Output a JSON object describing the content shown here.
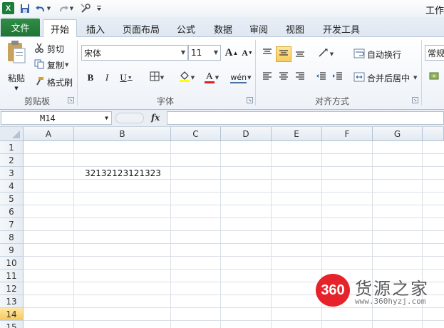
{
  "window": {
    "title": "工作"
  },
  "quick_access": {
    "app_icon": "X",
    "save_icon": "floppy-disk-icon",
    "undo_icon": "undo-icon",
    "redo_icon": "redo-icon",
    "customize_icon": "customize-icon"
  },
  "tabs": [
    {
      "label": "文件",
      "type": "file"
    },
    {
      "label": "开始",
      "active": true
    },
    {
      "label": "插入"
    },
    {
      "label": "页面布局"
    },
    {
      "label": "公式"
    },
    {
      "label": "数据"
    },
    {
      "label": "审阅"
    },
    {
      "label": "视图"
    },
    {
      "label": "开发工具"
    }
  ],
  "ribbon": {
    "clipboard": {
      "label": "剪贴板",
      "paste": "粘贴",
      "cut": "剪切",
      "copy": "复制",
      "format_painter": "格式刷"
    },
    "font": {
      "label": "字体",
      "font_name": "宋体",
      "font_size": "11",
      "bold": "B",
      "italic": "I",
      "underline": "U",
      "grow": "A",
      "shrink": "A",
      "font_color": "A",
      "wen": "wén"
    },
    "alignment": {
      "label": "对齐方式",
      "wrap_text": "自动换行",
      "merge_center": "合并后居中"
    },
    "number": {
      "format": "常规"
    }
  },
  "formula_bar": {
    "name_box": "M14",
    "fx": "fx",
    "value": ""
  },
  "grid": {
    "columns": [
      "A",
      "B",
      "C",
      "D",
      "E",
      "F",
      "G"
    ],
    "rows": [
      "1",
      "2",
      "3",
      "4",
      "5",
      "6",
      "7",
      "8",
      "9",
      "10",
      "11",
      "12",
      "13",
      "14",
      "15"
    ],
    "active_row": "14",
    "cells": {
      "B3": "32132123121323"
    }
  },
  "watermark": {
    "logo": "360",
    "name": "货源之家",
    "url": "www.360hyzj.com"
  },
  "colors": {
    "file_tab": "#1f7434",
    "selection": "#f8cc5a",
    "watermark_red": "#e6232a"
  }
}
